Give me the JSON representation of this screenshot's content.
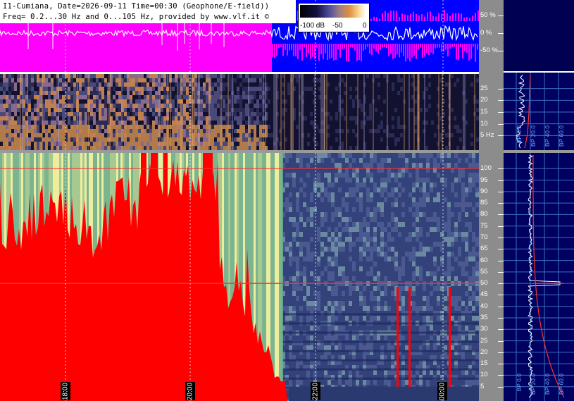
{
  "header": {
    "line1": "I1-Cumiana, Date=2026-09-11 Time=00:30 (Geophone/E-field))",
    "line2": "Freq= 0.2...30 Hz and 0...105 Hz, provided by www.vlf.it ©"
  },
  "colorbar": {
    "ticks": [
      "-100 dB",
      "-50",
      "0"
    ]
  },
  "chart_data": [
    {
      "type": "line",
      "name": "amplitude",
      "ylabel_ticks": [
        "50 %",
        "0 %",
        "-50 %"
      ],
      "colors": {
        "early": "#ff00ff",
        "late": "#0000ff",
        "trace": "#ffffff"
      }
    },
    {
      "type": "heatmap",
      "name": "elf-spectrogram",
      "y_unit": "Hz",
      "ylim": [
        0,
        30
      ],
      "y_ticks": [
        "25",
        "20",
        "15",
        "10",
        "5 Hz"
      ]
    },
    {
      "type": "heatmap",
      "name": "vlf-spectrogram",
      "ylim": [
        0,
        105
      ],
      "y_ticks": [
        "100",
        "95",
        "90",
        "85",
        "80",
        "75",
        "70",
        "65",
        "60",
        "55",
        "50",
        "45",
        "40",
        "35",
        "30",
        "25",
        "20",
        "15",
        "10",
        "5"
      ],
      "x_time_labels": [
        "18:00",
        "20:00",
        "22:00",
        "00:00"
      ],
      "hum_line_hz": 50,
      "colors": {
        "saturated": "#ff0000",
        "high": "#f0f0a0",
        "mid": "#60a080",
        "low": "#3a4a80"
      }
    },
    {
      "type": "line",
      "name": "spectrum-profile-elf",
      "bp_labels": [
        "BP 0.0",
        "BP 20.0",
        "BP 40.0",
        "BP 60.0"
      ]
    },
    {
      "type": "line",
      "name": "spectrum-profile-vlf",
      "bp_labels": [
        "BP 0.0",
        "BP 20.0",
        "BP 40.0",
        "BP 60.0"
      ]
    }
  ]
}
